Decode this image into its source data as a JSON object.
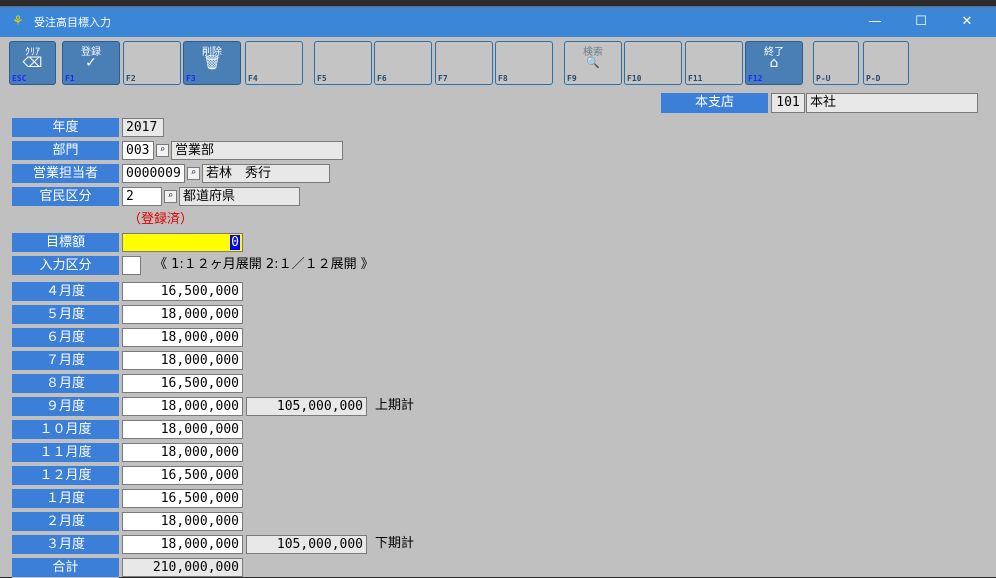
{
  "window": {
    "title": "受注高目標入力",
    "controls": {
      "minimize": "—",
      "maximize": "☐",
      "close": "✕"
    }
  },
  "toolbar": [
    {
      "label": "ｸﾘｱ",
      "code": "ESC",
      "icon": "eraser-icon",
      "glyph": "⌫",
      "active": true
    },
    {
      "label": "登録",
      "code": "F1",
      "icon": "checkmark-icon",
      "glyph": "✓",
      "active": true
    },
    {
      "label": "",
      "code": "F2",
      "active": false
    },
    {
      "label": "削除",
      "code": "F3",
      "icon": "trash-icon",
      "glyph": "🗑",
      "active": true
    },
    {
      "label": "",
      "code": "F4",
      "active": false
    },
    {
      "label": "",
      "code": "F5",
      "active": false
    },
    {
      "label": "",
      "code": "F6",
      "active": false
    },
    {
      "label": "",
      "code": "F7",
      "active": false
    },
    {
      "label": "",
      "code": "F8",
      "active": false
    },
    {
      "label": "検索",
      "code": "F9",
      "icon": "magnifier-icon",
      "glyph": "🔍",
      "active": false,
      "disabled": true
    },
    {
      "label": "",
      "code": "F10",
      "active": false
    },
    {
      "label": "",
      "code": "F11",
      "active": false
    },
    {
      "label": "終了",
      "code": "F12",
      "icon": "home-icon",
      "glyph": "⌂",
      "active": true
    },
    {
      "label": "",
      "code": "P-U",
      "active": false
    },
    {
      "label": "",
      "code": "P-D",
      "active": false
    }
  ],
  "branch": {
    "label": "本支店",
    "code": "101",
    "name": "本社"
  },
  "header": {
    "year": {
      "label": "年度",
      "value": "2017"
    },
    "department": {
      "label": "部門",
      "code": "003",
      "name": "営業部"
    },
    "person": {
      "label": "営業担当者",
      "code": "0000009",
      "name": "若林　秀行"
    },
    "sector": {
      "label": "官民区分",
      "code": "2",
      "name": "都道府県"
    },
    "status": "（登録済）"
  },
  "target": {
    "label": "目標額",
    "value": "0"
  },
  "input_type": {
    "label": "入力区分",
    "value": "",
    "hint": "《 1:１２ヶ月展開 2:１／１２展開 》"
  },
  "months": [
    {
      "label": "４月度",
      "value": "16,500,000"
    },
    {
      "label": "５月度",
      "value": "18,000,000"
    },
    {
      "label": "６月度",
      "value": "18,000,000"
    },
    {
      "label": "７月度",
      "value": "18,000,000"
    },
    {
      "label": "８月度",
      "value": "16,500,000"
    },
    {
      "label": "９月度",
      "value": "18,000,000",
      "subtotal": "105,000,000",
      "subtotal_label": "上期計"
    },
    {
      "label": "１０月度",
      "value": "18,000,000"
    },
    {
      "label": "１１月度",
      "value": "18,000,000"
    },
    {
      "label": "１２月度",
      "value": "16,500,000"
    },
    {
      "label": "１月度",
      "value": "16,500,000"
    },
    {
      "label": "２月度",
      "value": "18,000,000"
    },
    {
      "label": "３月度",
      "value": "18,000,000",
      "subtotal": "105,000,000",
      "subtotal_label": "下期計"
    }
  ],
  "total": {
    "label": "合計",
    "value": "210,000,000"
  }
}
